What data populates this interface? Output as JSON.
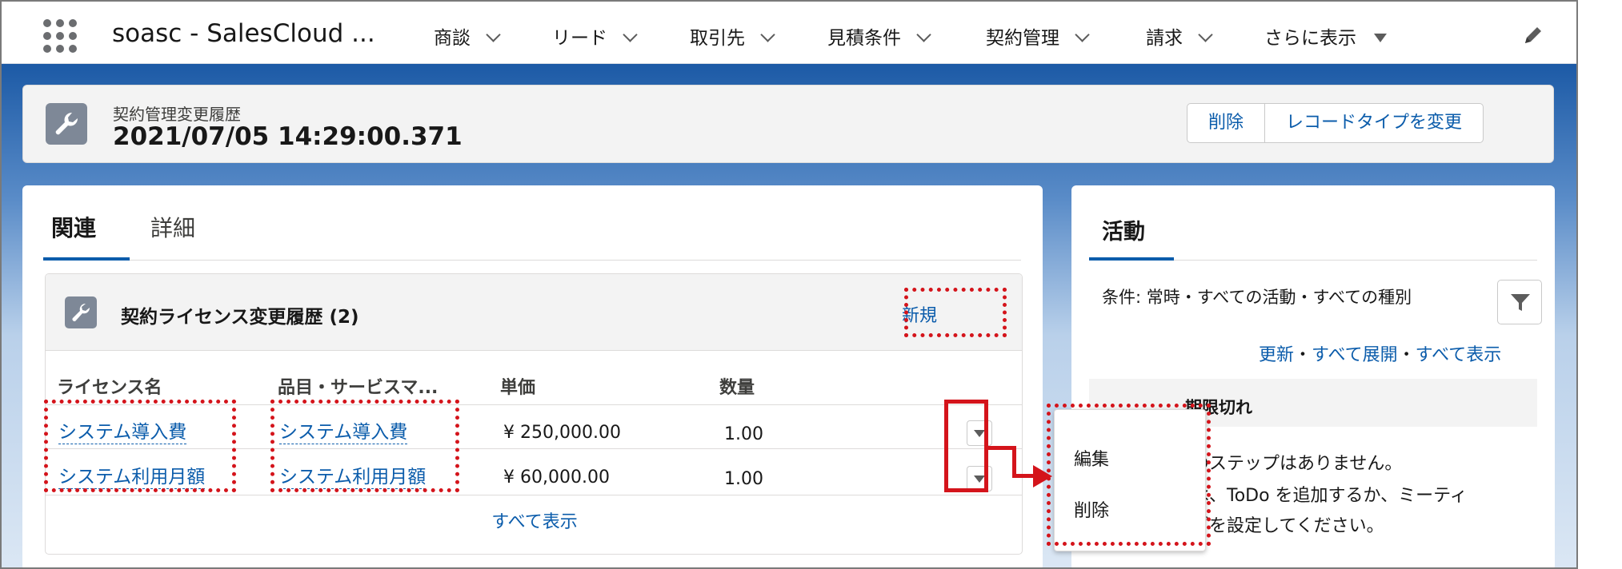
{
  "nav": {
    "app_name": "soasc - SalesCloud ...",
    "items": [
      "商談",
      "リード",
      "取引先",
      "見積条件",
      "契約管理",
      "請求"
    ],
    "more_label": "さらに表示"
  },
  "record": {
    "object_label": "契約管理変更履歴",
    "title": "2021/07/05 14:29:00.371",
    "buttons": [
      "削除",
      "レコードタイプを変更"
    ]
  },
  "main": {
    "tabs": [
      "関連",
      "詳細"
    ],
    "related_list": {
      "title": "契約ライセンス変更履歴 (2)",
      "new_label": "新規",
      "columns": [
        "ライセンス名",
        "品目・サービスマ...",
        "単価",
        "数量"
      ],
      "rows": [
        {
          "license": "システム導入費",
          "item": "システム導入費",
          "price": "¥ 250,000.00",
          "qty": "1.00"
        },
        {
          "license": "システム利用月額",
          "item": "システム利用月額",
          "price": "¥ 60,000.00",
          "qty": "1.00"
        }
      ],
      "view_all": "すべて表示"
    }
  },
  "activity": {
    "title": "活動",
    "filter_text": "条件: 常時・すべての活動・すべての種別",
    "links": {
      "refresh": "更新",
      "sep": "・",
      "expand_all": "すべて展開",
      "view_all": "すべて表示"
    },
    "section_label": "期限切れ",
    "empty_lines": [
      "のステップはありません。",
      "は、ToDo を追加するか、ミーティ",
      "グを設定してください。"
    ]
  },
  "row_menu": {
    "items": [
      "編集",
      "削除"
    ]
  },
  "colors": {
    "brand_blue": "#0b5cab",
    "annotation_red": "#d4141b",
    "icon_gray": "#7e8897"
  }
}
